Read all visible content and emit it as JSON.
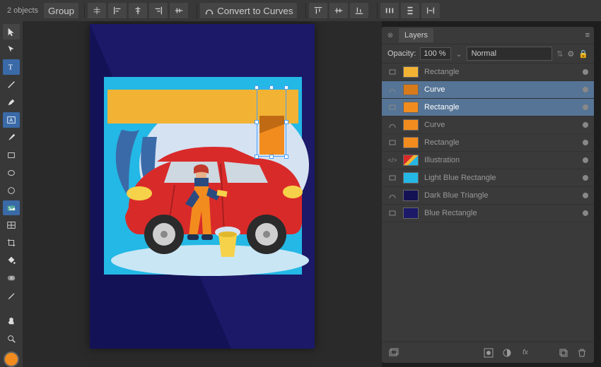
{
  "topbar": {
    "selection_label": "2 objects",
    "group_label": "Group",
    "convert_label": "Convert to Curves"
  },
  "panel": {
    "tab_label": "Layers",
    "opacity_label": "Opacity:",
    "opacity_value": "100 %",
    "blend_mode": "Normal"
  },
  "layers": [
    {
      "name": "Rectangle",
      "thumb_color": "#f2b335",
      "type": "rect",
      "selected": false
    },
    {
      "name": "Curve",
      "thumb_color": "#d77a1c",
      "type": "curve",
      "selected": true
    },
    {
      "name": "Rectangle",
      "thumb_color": "#f28c1e",
      "type": "rect",
      "selected": true
    },
    {
      "name": "Curve",
      "thumb_color": "#f28c1e",
      "type": "curve",
      "selected": false
    },
    {
      "name": "Rectangle",
      "thumb_color": "#f28c1e",
      "type": "rect",
      "selected": false
    },
    {
      "name": "Illustration",
      "thumb_color": "illus",
      "type": "group",
      "selected": false
    },
    {
      "name": "Light Blue Rectangle",
      "thumb_color": "#23b8e5",
      "type": "rect",
      "selected": false
    },
    {
      "name": "Dark Blue Triangle",
      "thumb_color": "#141255",
      "type": "curve",
      "selected": false
    },
    {
      "name": "Blue Rectangle",
      "thumb_color": "#1b1968",
      "type": "rect",
      "selected": false
    }
  ],
  "colors": {
    "fill": "#f28c1e"
  }
}
